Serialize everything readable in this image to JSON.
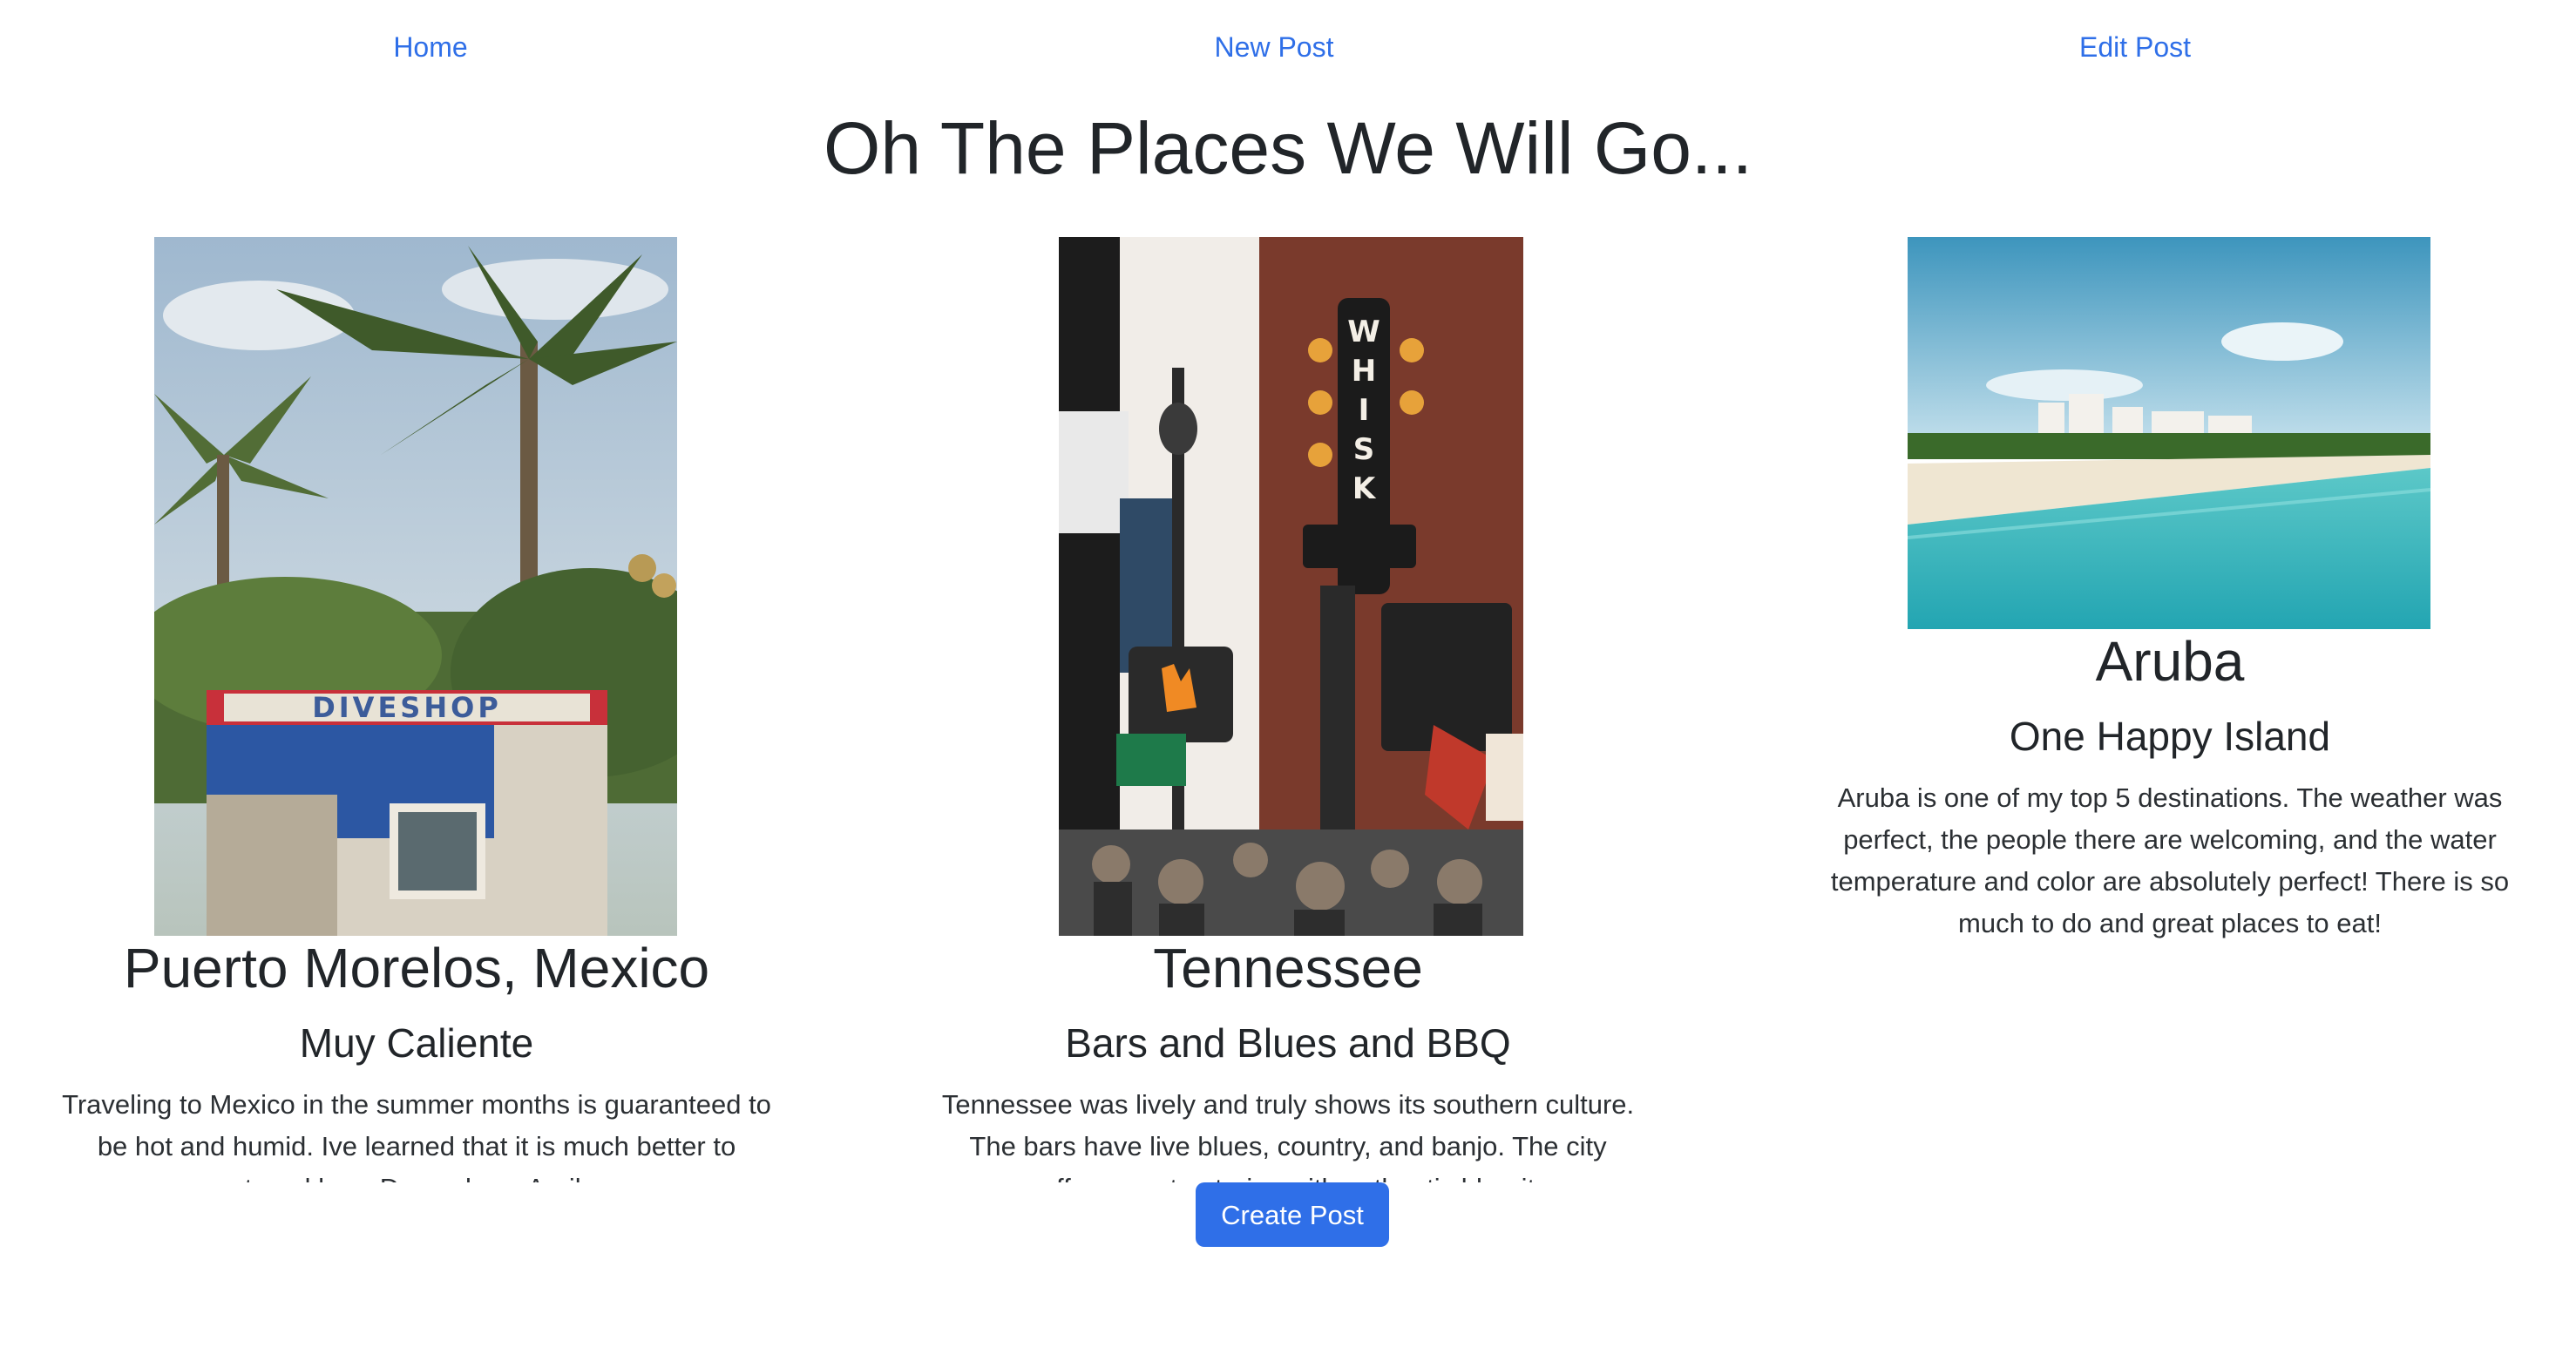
{
  "nav": {
    "home": "Home",
    "new_post": "New Post",
    "edit_post": "Edit Post"
  },
  "page": {
    "title": "Oh The Places We Will Go..."
  },
  "posts": [
    {
      "title": "Puerto Morelos, Mexico",
      "subtitle": "Muy Caliente",
      "body": "Traveling to Mexico in the summer months is guaranteed to be hot and humid. Ive learned that it is much better to travel here December - April.",
      "image": "dive-shop-palm-trees-photo"
    },
    {
      "title": "Tennessee",
      "subtitle": "Bars and Blues and BBQ",
      "body": "Tennessee was lively and truly shows its southern culture. The bars have live blues, country, and banjo. The city offers great eateries with authentic bbq, it",
      "image": "nashville-street-signs-photo"
    },
    {
      "title": "Aruba",
      "subtitle": "One Happy Island",
      "body": "Aruba is one of my top 5 destinations. The weather was perfect, the people there are welcoming, and the water temperature and color are absolutely perfect! There is so much to do and great places to eat!",
      "image": "beach-turquoise-water-photo"
    }
  ],
  "actions": {
    "create_post": "Create Post"
  },
  "colors": {
    "link": "#2f6fe8",
    "button": "#2f6fe8",
    "text": "#212529"
  }
}
